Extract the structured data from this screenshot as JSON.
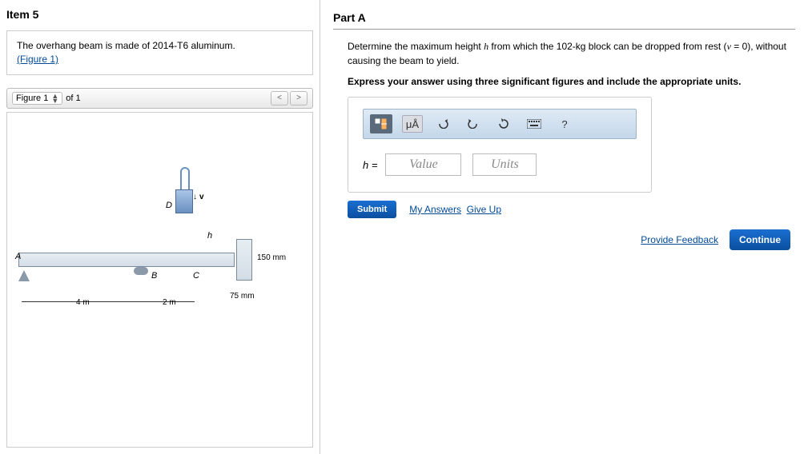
{
  "item_header": "Item 5",
  "problem": {
    "text": "The overhang beam is made of 2014-T6 aluminum.",
    "figure_link": "(Figure 1)"
  },
  "figure_nav": {
    "label": "Figure 1",
    "of_text": "of 1"
  },
  "figure_labels": {
    "A": "A",
    "B": "B",
    "C": "C",
    "D": "D",
    "h": "h",
    "v": "v",
    "dim_4m": "4 m",
    "dim_2m": "2 m",
    "dim_150": "150 mm",
    "dim_75": "75 mm"
  },
  "part": {
    "title": "Part A",
    "question_pre": "Determine the maximum height ",
    "question_var": "h",
    "question_mid": " from which the 102-kg block can be dropped from rest (",
    "question_var2": "v",
    "question_post": " = 0), without causing the beam to yield.",
    "instruction": "Express your answer using three significant figures and include the appropriate units."
  },
  "toolbar": {
    "mu_a": "μÅ",
    "help": "?"
  },
  "answer": {
    "h_label": "h =",
    "value_placeholder": "Value",
    "units_placeholder": "Units"
  },
  "actions": {
    "submit": "Submit",
    "my_answers": "My Answers",
    "give_up": "Give Up",
    "feedback": "Provide Feedback",
    "continue": "Continue"
  }
}
